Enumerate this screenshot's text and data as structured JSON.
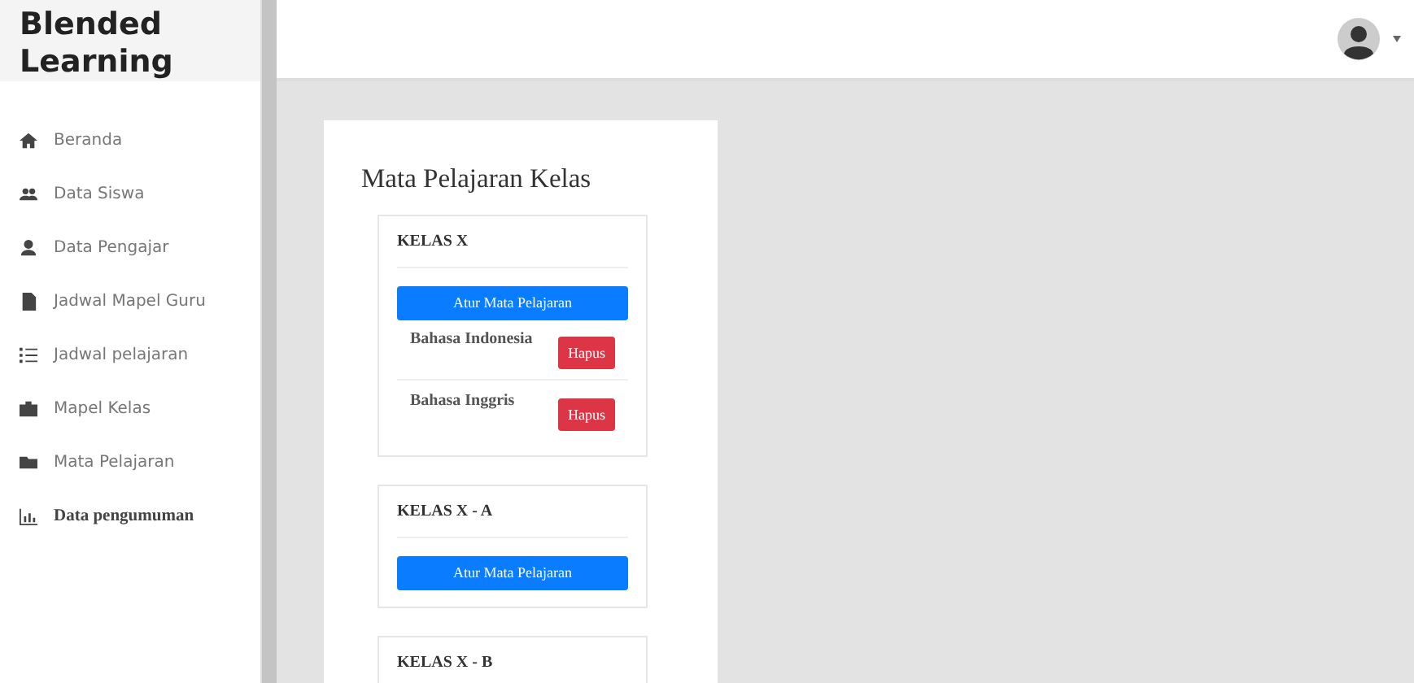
{
  "brand": "Blended Learning",
  "sidebar": {
    "items": [
      {
        "label": "Beranda",
        "kind": "plain"
      },
      {
        "label": "Data Siswa",
        "kind": "plain"
      },
      {
        "label": "Data Pengajar",
        "kind": "plain"
      },
      {
        "label": "Jadwal Mapel Guru",
        "kind": "plain"
      },
      {
        "label": "Jadwal pelajaran",
        "kind": "plain"
      },
      {
        "label": "Mapel Kelas",
        "kind": "plain"
      },
      {
        "label": "Mata Pelajaran",
        "kind": "plain"
      },
      {
        "label": "Data pengumuman",
        "kind": "serif"
      }
    ]
  },
  "main": {
    "title": "Mata Pelajaran Kelas",
    "classes": [
      {
        "name": "KELAS X",
        "button": "Atur Mata Pelajaran",
        "subjects": [
          {
            "name": "Bahasa Indonesia",
            "action": "Hapus"
          },
          {
            "name": "Bahasa Inggris",
            "action": "Hapus"
          }
        ]
      },
      {
        "name": "KELAS X - A",
        "button": "Atur Mata Pelajaran"
      },
      {
        "name": "KELAS X - B"
      }
    ]
  }
}
